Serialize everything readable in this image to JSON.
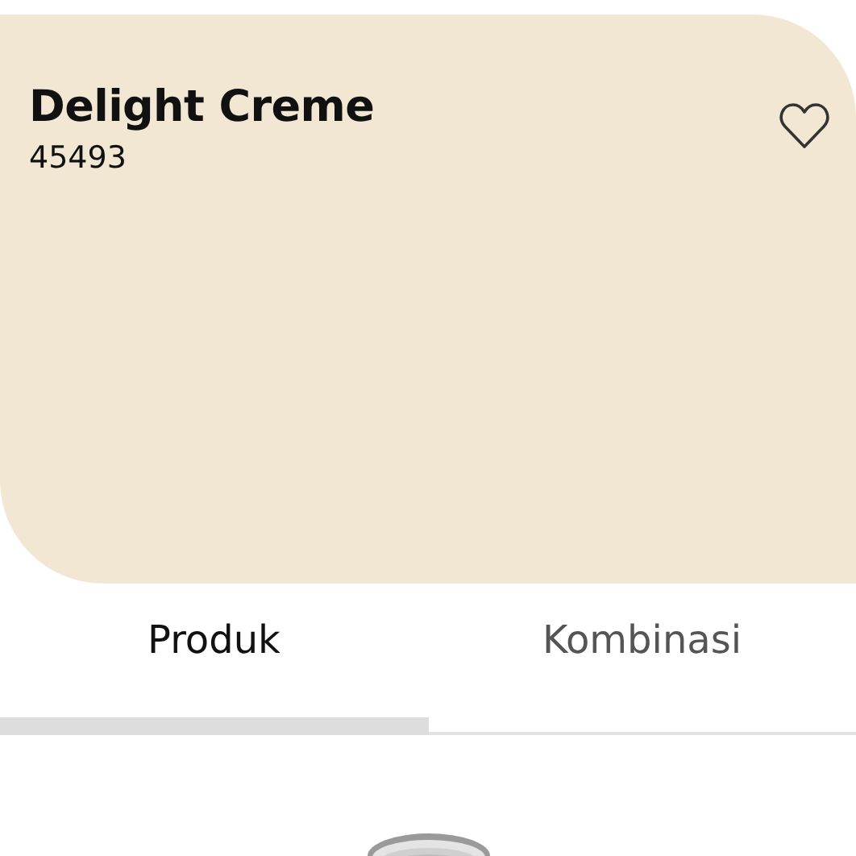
{
  "swatch": {
    "name": "Delight Creme",
    "code": "45493",
    "color": "#f2e7d3",
    "favorite": false
  },
  "tabs": [
    {
      "label": "Produk",
      "selected": true
    },
    {
      "label": "Kombinasi",
      "selected": false
    }
  ]
}
